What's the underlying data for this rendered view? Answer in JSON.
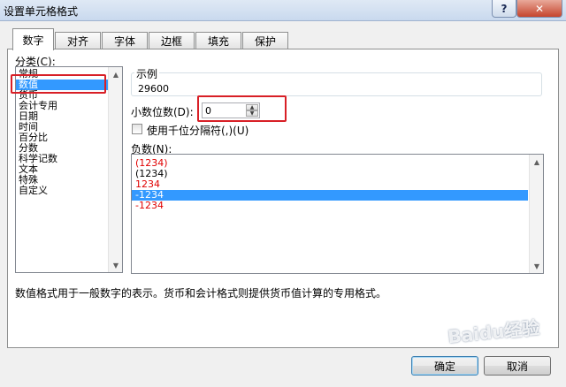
{
  "window": {
    "title": "设置单元格格式",
    "help": "?",
    "close": "✕"
  },
  "tabs": [
    {
      "label": "数字",
      "active": true
    },
    {
      "label": "对齐",
      "active": false
    },
    {
      "label": "字体",
      "active": false
    },
    {
      "label": "边框",
      "active": false
    },
    {
      "label": "填充",
      "active": false
    },
    {
      "label": "保护",
      "active": false
    }
  ],
  "category": {
    "label": "分类(C):",
    "items": [
      "常规",
      "数值",
      "货币",
      "会计专用",
      "日期",
      "时间",
      "百分比",
      "分数",
      "科学记数",
      "文本",
      "特殊",
      "自定义"
    ],
    "selected": "数值"
  },
  "sample": {
    "label": "示例",
    "value": "29600"
  },
  "decimal_places": {
    "label": "小数位数(D):",
    "value": "0"
  },
  "thousands_separator": {
    "label": "使用千位分隔符(,)(U)",
    "checked": false
  },
  "negative_numbers": {
    "label": "负数(N):",
    "items": [
      {
        "text": "(1234)",
        "color": "#e00000"
      },
      {
        "text": "(1234)",
        "color": "#000000"
      },
      {
        "text": "1234",
        "color": "#e00000"
      },
      {
        "text": "-1234",
        "color": "#000000"
      },
      {
        "text": "-1234",
        "color": "#e00000"
      }
    ],
    "selected": "-1234"
  },
  "description": "数值格式用于一般数字的表示。货币和会计格式则提供货币值计算的专用格式。",
  "buttons": {
    "ok": "确定",
    "cancel": "取消"
  },
  "watermark": "Baidu经验",
  "colors": {
    "selection": "#3399ff",
    "highlight": "#d81f26",
    "negative_red": "#e00000"
  }
}
